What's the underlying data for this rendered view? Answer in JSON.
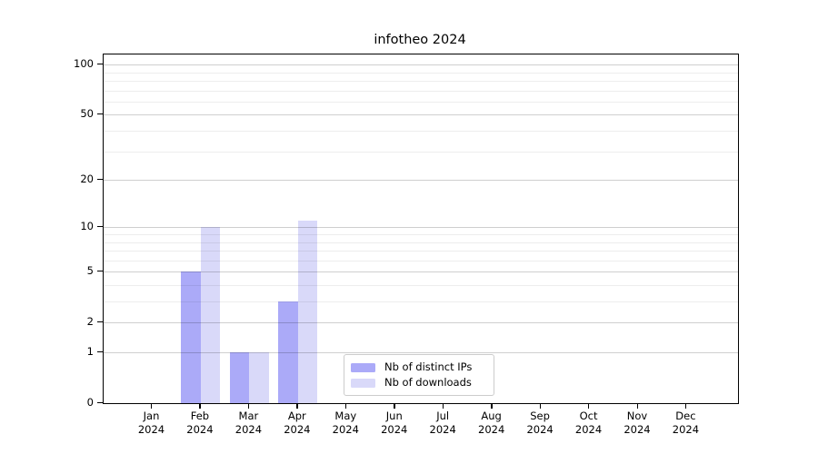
{
  "chart_data": {
    "type": "bar",
    "title": "infotheo 2024",
    "categories": [
      "Jan",
      "Feb",
      "Mar",
      "Apr",
      "May",
      "Jun",
      "Jul",
      "Aug",
      "Sep",
      "Oct",
      "Nov",
      "Dec"
    ],
    "year_label": "2024",
    "series": [
      {
        "name": "Nb of distinct IPs",
        "color": "#abaaf8",
        "values": [
          0,
          5,
          1,
          3,
          0,
          0,
          0,
          0,
          0,
          0,
          0,
          0
        ]
      },
      {
        "name": "Nb of downloads",
        "color": "#d9d9f9",
        "values": [
          0,
          10,
          1,
          11,
          0,
          0,
          0,
          0,
          0,
          0,
          0,
          0
        ]
      }
    ],
    "yscale": "log1p",
    "ylim": [
      0,
      115
    ],
    "y_tick_labels": [
      0,
      1,
      2,
      5,
      10,
      20,
      50,
      100
    ],
    "y_major_gridlines": [
      1,
      2,
      5,
      10,
      20,
      50,
      100
    ],
    "y_minor_gridlines": [
      3,
      4,
      6,
      7,
      8,
      9,
      30,
      40,
      60,
      70,
      80,
      90
    ],
    "grid": true,
    "legend_position": "lower-center",
    "colors": {
      "axis": "#000000",
      "major_grid": "#cfcfcf",
      "minor_grid": "#ededed",
      "background": "#ffffff"
    }
  }
}
